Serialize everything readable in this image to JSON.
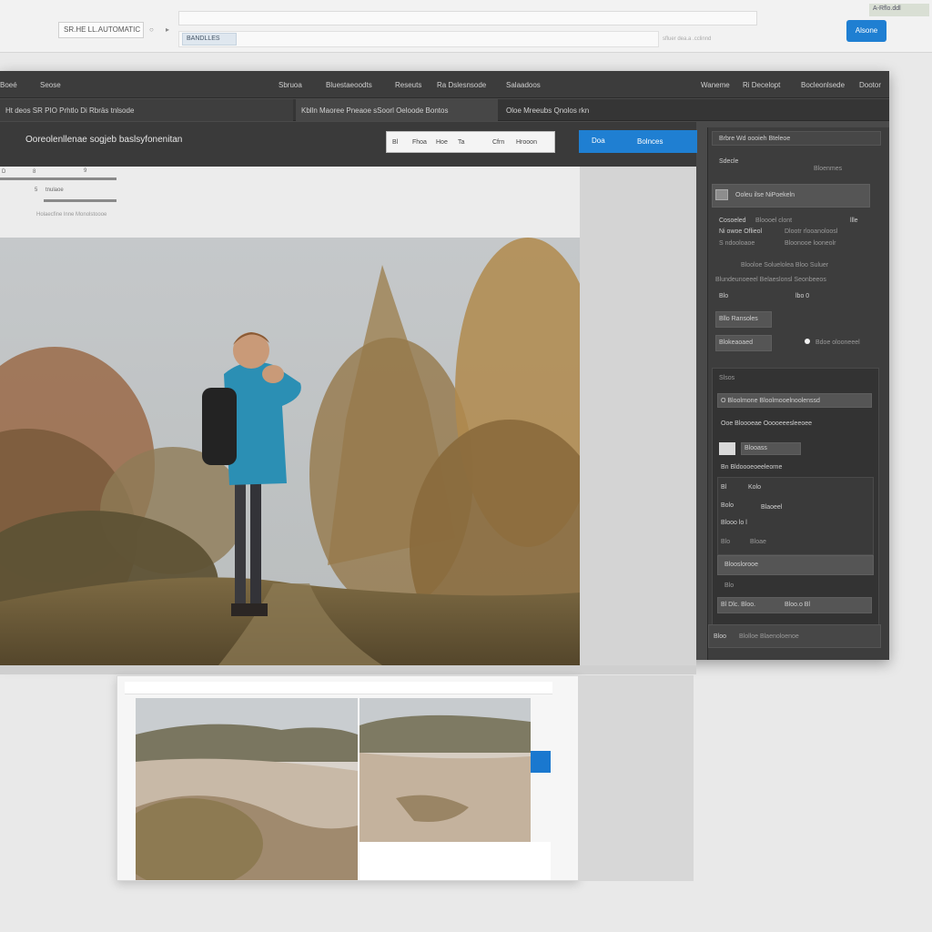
{
  "browser": {
    "url": "SR.HE LL.AUTOMATIC",
    "nav_glyphs": [
      "○",
      "▸"
    ],
    "sub_chip": "BANDLLES",
    "sub_hint": "sfluer dea.a .cclinnd",
    "top_tag": "A-Rflo.ddl",
    "top_button": "Alsone"
  },
  "menubar": {
    "items": [
      "Boeé",
      "Seose",
      "Sbruoa",
      "Bluestaeoodts",
      "Reseuts",
      "Ra Dslesnsode",
      "Salaadoos",
      "Waneme",
      "Ri Decelopt",
      "Bocleonlsede",
      "Dootor"
    ]
  },
  "tabs": [
    "Ht deos SR PIO Prhtlo Di Rbräs tnlsode",
    "Kblln Maoree Pneaoe sSoorl Oeloode Bontos",
    "Oloe Mreeubs Qnolos rkn"
  ],
  "document": {
    "title": "Ooreolenllenae sogjeb baslsyfonenitan"
  },
  "search": {
    "segments": [
      "Bl",
      "Fhoa",
      "Hoe",
      "Ta",
      "Cfrn",
      "Hrooon"
    ]
  },
  "primary_button": {
    "left": "Doa",
    "label": "Bolnces"
  },
  "canvas": {
    "ruler": [
      "D",
      "8",
      "9",
      "5",
      "tnulaoe",
      "Holaecfine lnne Monolstoooe"
    ]
  },
  "panel": {
    "header": "Brbre Wd oooieh Bteleoe",
    "row1_left": "Sdecle",
    "row1_right": "Bloenmes",
    "section_title": "Ooleu ilse NiPoekeln",
    "props": [
      {
        "k": "Cosoeled",
        "v": "Bloooel clont",
        "n": "llle"
      },
      {
        "k": "Ni owoe Oflieol",
        "v": "Dlootr rlooanoloosl"
      },
      {
        "k": "S ndooloaoe",
        "v": "Bloonooe looneolr"
      }
    ],
    "center_line": "Blooloe Soluelolea Bloo Suluer",
    "line2": "Blundeunoeeel Belaeslonsl Seonbeeos",
    "size_row": {
      "k": "Blo",
      "v": "lbo 0"
    },
    "button_a": "Bllo Ransoles",
    "button_b": "Blokeaoaed",
    "toggle_label": "Bdoe olooneeel",
    "layers_title": "Slsos",
    "layers": [
      "O Bloolmone Bloolmooelnoolenssd",
      "Ooe Bloooeae Ooooeeesleeoee",
      "Blooass",
      "Bn  Bldoooeoeeleorne"
    ],
    "list": [
      {
        "k": "Bl",
        "v": "Kolo"
      },
      {
        "k": "Bolo",
        "v": "Blaoeel"
      },
      {
        "k": "Blooo lo l",
        "v": ""
      },
      {
        "k": "Blo",
        "v": "Bloae"
      }
    ],
    "list_footer": "Blooslorooe",
    "list_item5": "Blo",
    "bottom_a": "Bl Dlc. Bloo.",
    "bottom_b": "Bloo.o Bl",
    "footer_a": "Bloo",
    "footer_b": "Blolloe Blaenoloenoe"
  }
}
